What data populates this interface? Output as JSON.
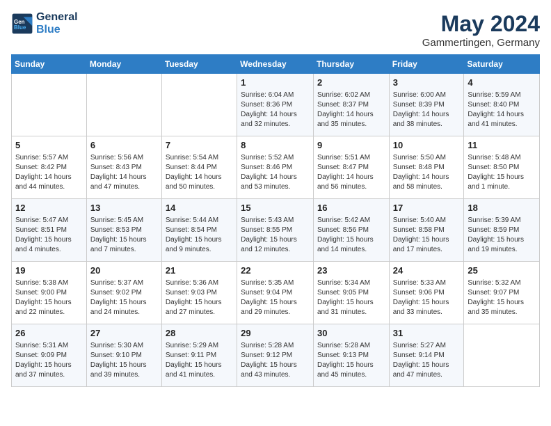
{
  "header": {
    "logo_line1": "General",
    "logo_line2": "Blue",
    "month": "May 2024",
    "location": "Gammertingen, Germany"
  },
  "days_of_week": [
    "Sunday",
    "Monday",
    "Tuesday",
    "Wednesday",
    "Thursday",
    "Friday",
    "Saturday"
  ],
  "weeks": [
    [
      {
        "day": "",
        "info": ""
      },
      {
        "day": "",
        "info": ""
      },
      {
        "day": "",
        "info": ""
      },
      {
        "day": "1",
        "info": "Sunrise: 6:04 AM\nSunset: 8:36 PM\nDaylight: 14 hours\nand 32 minutes."
      },
      {
        "day": "2",
        "info": "Sunrise: 6:02 AM\nSunset: 8:37 PM\nDaylight: 14 hours\nand 35 minutes."
      },
      {
        "day": "3",
        "info": "Sunrise: 6:00 AM\nSunset: 8:39 PM\nDaylight: 14 hours\nand 38 minutes."
      },
      {
        "day": "4",
        "info": "Sunrise: 5:59 AM\nSunset: 8:40 PM\nDaylight: 14 hours\nand 41 minutes."
      }
    ],
    [
      {
        "day": "5",
        "info": "Sunrise: 5:57 AM\nSunset: 8:42 PM\nDaylight: 14 hours\nand 44 minutes."
      },
      {
        "day": "6",
        "info": "Sunrise: 5:56 AM\nSunset: 8:43 PM\nDaylight: 14 hours\nand 47 minutes."
      },
      {
        "day": "7",
        "info": "Sunrise: 5:54 AM\nSunset: 8:44 PM\nDaylight: 14 hours\nand 50 minutes."
      },
      {
        "day": "8",
        "info": "Sunrise: 5:52 AM\nSunset: 8:46 PM\nDaylight: 14 hours\nand 53 minutes."
      },
      {
        "day": "9",
        "info": "Sunrise: 5:51 AM\nSunset: 8:47 PM\nDaylight: 14 hours\nand 56 minutes."
      },
      {
        "day": "10",
        "info": "Sunrise: 5:50 AM\nSunset: 8:48 PM\nDaylight: 14 hours\nand 58 minutes."
      },
      {
        "day": "11",
        "info": "Sunrise: 5:48 AM\nSunset: 8:50 PM\nDaylight: 15 hours\nand 1 minute."
      }
    ],
    [
      {
        "day": "12",
        "info": "Sunrise: 5:47 AM\nSunset: 8:51 PM\nDaylight: 15 hours\nand 4 minutes."
      },
      {
        "day": "13",
        "info": "Sunrise: 5:45 AM\nSunset: 8:53 PM\nDaylight: 15 hours\nand 7 minutes."
      },
      {
        "day": "14",
        "info": "Sunrise: 5:44 AM\nSunset: 8:54 PM\nDaylight: 15 hours\nand 9 minutes."
      },
      {
        "day": "15",
        "info": "Sunrise: 5:43 AM\nSunset: 8:55 PM\nDaylight: 15 hours\nand 12 minutes."
      },
      {
        "day": "16",
        "info": "Sunrise: 5:42 AM\nSunset: 8:56 PM\nDaylight: 15 hours\nand 14 minutes."
      },
      {
        "day": "17",
        "info": "Sunrise: 5:40 AM\nSunset: 8:58 PM\nDaylight: 15 hours\nand 17 minutes."
      },
      {
        "day": "18",
        "info": "Sunrise: 5:39 AM\nSunset: 8:59 PM\nDaylight: 15 hours\nand 19 minutes."
      }
    ],
    [
      {
        "day": "19",
        "info": "Sunrise: 5:38 AM\nSunset: 9:00 PM\nDaylight: 15 hours\nand 22 minutes."
      },
      {
        "day": "20",
        "info": "Sunrise: 5:37 AM\nSunset: 9:02 PM\nDaylight: 15 hours\nand 24 minutes."
      },
      {
        "day": "21",
        "info": "Sunrise: 5:36 AM\nSunset: 9:03 PM\nDaylight: 15 hours\nand 27 minutes."
      },
      {
        "day": "22",
        "info": "Sunrise: 5:35 AM\nSunset: 9:04 PM\nDaylight: 15 hours\nand 29 minutes."
      },
      {
        "day": "23",
        "info": "Sunrise: 5:34 AM\nSunset: 9:05 PM\nDaylight: 15 hours\nand 31 minutes."
      },
      {
        "day": "24",
        "info": "Sunrise: 5:33 AM\nSunset: 9:06 PM\nDaylight: 15 hours\nand 33 minutes."
      },
      {
        "day": "25",
        "info": "Sunrise: 5:32 AM\nSunset: 9:07 PM\nDaylight: 15 hours\nand 35 minutes."
      }
    ],
    [
      {
        "day": "26",
        "info": "Sunrise: 5:31 AM\nSunset: 9:09 PM\nDaylight: 15 hours\nand 37 minutes."
      },
      {
        "day": "27",
        "info": "Sunrise: 5:30 AM\nSunset: 9:10 PM\nDaylight: 15 hours\nand 39 minutes."
      },
      {
        "day": "28",
        "info": "Sunrise: 5:29 AM\nSunset: 9:11 PM\nDaylight: 15 hours\nand 41 minutes."
      },
      {
        "day": "29",
        "info": "Sunrise: 5:28 AM\nSunset: 9:12 PM\nDaylight: 15 hours\nand 43 minutes."
      },
      {
        "day": "30",
        "info": "Sunrise: 5:28 AM\nSunset: 9:13 PM\nDaylight: 15 hours\nand 45 minutes."
      },
      {
        "day": "31",
        "info": "Sunrise: 5:27 AM\nSunset: 9:14 PM\nDaylight: 15 hours\nand 47 minutes."
      },
      {
        "day": "",
        "info": ""
      }
    ]
  ]
}
